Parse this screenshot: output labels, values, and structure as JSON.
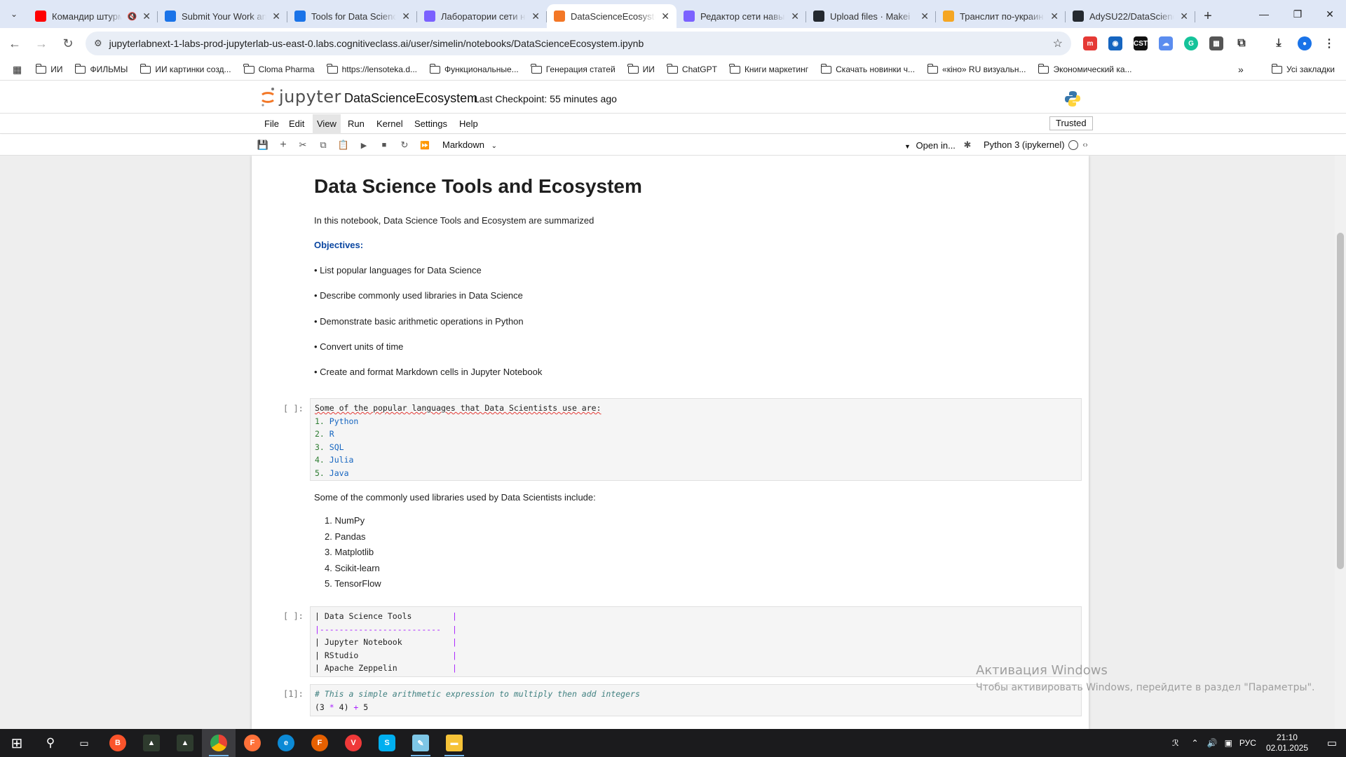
{
  "browser": {
    "tabs": [
      {
        "title": "Командир штурм",
        "favicon": "youtube-icon",
        "color": "#ff0000",
        "muted": true
      },
      {
        "title": "Submit Your Work and",
        "favicon": "google-classroom-icon",
        "color": "#1a73e8"
      },
      {
        "title": "Tools for Data Science",
        "favicon": "google-icon",
        "color": "#1a73e8"
      },
      {
        "title": "Лаборатории сети н",
        "favicon": "ai-icon",
        "color": "#7b61ff"
      },
      {
        "title": "DataScienceEcosystem",
        "favicon": "jupyter-icon",
        "color": "#f37726",
        "active": true
      },
      {
        "title": "Редактор сети навы",
        "favicon": "ai-icon",
        "color": "#7b61ff"
      },
      {
        "title": "Upload files · Makei",
        "favicon": "github-icon",
        "color": "#24292f"
      },
      {
        "title": "Транслит по-украин",
        "favicon": "translit-icon",
        "color": "#f5a623"
      },
      {
        "title": "AdySU22/DataScienc",
        "favicon": "github-icon",
        "color": "#24292f"
      }
    ],
    "url": "jupyterlabnext-1-labs-prod-jupyterlab-us-east-0.labs.cognitiveclass.ai/user/simelin/notebooks/DataScienceEcosystem.ipynb",
    "bookmarks": [
      "ИИ",
      "ФИЛЬМЫ",
      "ИИ картинки созд...",
      "Cloma Pharma",
      "https://lensoteka.d...",
      "Функциональные...",
      "Генерация статей",
      "ИИ",
      "ChatGPT",
      "Книги маркетинг",
      "Скачать новинки ч...",
      "«кіно» RU визуальн...",
      "Экономический ка..."
    ],
    "all_bookmarks": "Усі закладки"
  },
  "jupyter": {
    "logo_text": "jupyter",
    "notebook_title": "DataScienceEcosystem",
    "checkpoint": "Last Checkpoint: 55 minutes ago",
    "menus": [
      "File",
      "Edit",
      "View",
      "Run",
      "Kernel",
      "Settings",
      "Help"
    ],
    "active_menu": "View",
    "trusted": "Trusted",
    "cell_type": "Markdown",
    "open_in": "Open in...",
    "kernel": "Python 3 (ipykernel)"
  },
  "notebook": {
    "h1": "Data Science Tools and Ecosystem",
    "intro": "In this notebook, Data Science Tools and Ecosystem are summarized",
    "objectives_label": "Objectives:",
    "objectives": [
      "• List popular languages for Data Science",
      "• Describe commonly used libraries in Data Science",
      "• Demonstrate basic arithmetic operations in Python",
      "• Convert units of time",
      "• Create and format Markdown cells in Jupyter Notebook"
    ],
    "cell1_prompt": "[ ]:",
    "cell1_header": "Some of the popular languages that Data Scientists use are:",
    "cell1_items": [
      {
        "n": "1.",
        "v": "Python"
      },
      {
        "n": "2.",
        "v": "R"
      },
      {
        "n": "3.",
        "v": "SQL"
      },
      {
        "n": "4.",
        "v": "Julia"
      },
      {
        "n": "5.",
        "v": "Java"
      }
    ],
    "libraries_intro": "Some of the commonly used libraries used by Data Scientists include:",
    "libraries": [
      "1. NumPy",
      "2. Pandas",
      "3. Matplotlib",
      "4. Scikit-learn",
      "5. TensorFlow"
    ],
    "cell2_prompt": "[ ]:",
    "table_lines": [
      {
        "a": "| Data Science Tools",
        "b": "|"
      },
      {
        "a": "|-------------------------",
        "b": "|"
      },
      {
        "a": "| Jupyter Notebook",
        "b": "|"
      },
      {
        "a": "| RStudio",
        "b": "|"
      },
      {
        "a": "| Apache Zeppelin",
        "b": "|"
      }
    ],
    "cell3_prompt": "[1]:",
    "cell3_comment": "# This a simple arithmetic expression to multiply then add integers",
    "cell3_code": {
      "p1": "(3 ",
      "op1": "*",
      "p2": " 4) ",
      "op2": "+",
      "p3": " 5"
    }
  },
  "watermark": {
    "title": "Активация Windows",
    "subtitle": "Чтобы активировать Windows, перейдите в раздел \"Параметры\"."
  },
  "taskbar": {
    "lang": "РУС",
    "time": "21:10",
    "date": "02.01.2025"
  }
}
